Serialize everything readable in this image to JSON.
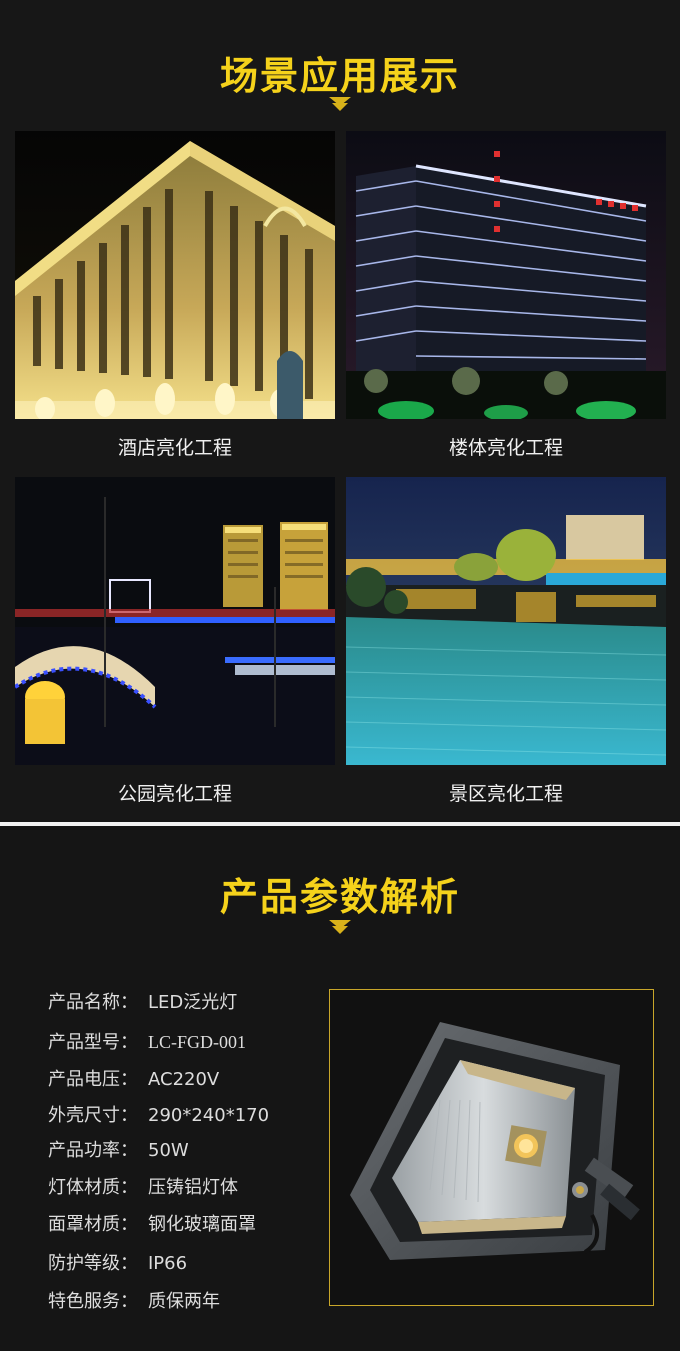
{
  "scenes_section": {
    "title": "场景应用展示",
    "tiles": [
      {
        "label": "酒店亮化工程",
        "image": "hotel-facade-lighting"
      },
      {
        "label": "楼体亮化工程",
        "image": "office-building-lighting"
      },
      {
        "label": "公园亮化工程",
        "image": "park-bridge-lighting"
      },
      {
        "label": "景区亮化工程",
        "image": "scenic-lake-lighting"
      }
    ]
  },
  "params_section": {
    "title": "产品参数解析",
    "specs": [
      {
        "key": "产品名称：",
        "value": "LED泛光灯"
      },
      {
        "key": "产品型号：",
        "value": "LC-FGD-001"
      },
      {
        "key": "产品电压：",
        "value": "AC220V"
      },
      {
        "key": "外壳尺寸：",
        "value": "290*240*170"
      },
      {
        "key": "产品功率：",
        "value": "50W"
      },
      {
        "key": "灯体材质：",
        "value": "压铸铝灯体"
      },
      {
        "key": "面罩材质：",
        "value": "钢化玻璃面罩"
      },
      {
        "key": "防护等级：",
        "value": "IP66"
      },
      {
        "key": "特色服务：",
        "value": "质保两年"
      }
    ],
    "product_image": "led-floodlight-photo"
  },
  "colors": {
    "accent": "#f5d21b",
    "chevron": "#d8b21a",
    "frame": "#c8a62a"
  }
}
